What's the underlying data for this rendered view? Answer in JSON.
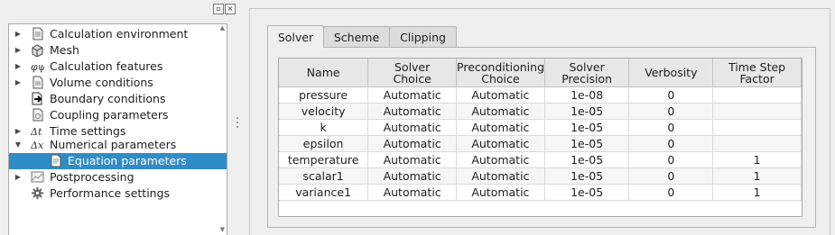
{
  "tree": {
    "items": [
      {
        "label": "Calculation environment",
        "icon": "folder-document-icon",
        "expander": "collapsed",
        "selected": false
      },
      {
        "label": "Mesh",
        "icon": "mesh-cube-icon",
        "expander": "collapsed",
        "selected": false
      },
      {
        "label": "Calculation features",
        "icon": "phi-psi-icon",
        "expander": "collapsed",
        "selected": false
      },
      {
        "label": "Volume conditions",
        "icon": "volume-document-icon",
        "expander": "collapsed",
        "selected": false
      },
      {
        "label": "Boundary conditions",
        "icon": "boundary-arrow-icon",
        "expander": "none",
        "selected": false
      },
      {
        "label": "Coupling parameters",
        "icon": "coupling-document-icon",
        "expander": "none",
        "selected": false
      },
      {
        "label": "Time settings",
        "icon": "delta-t-icon",
        "expander": "collapsed",
        "selected": false
      },
      {
        "label": "Numerical parameters",
        "icon": "delta-x-icon",
        "expander": "expanded",
        "selected": false
      },
      {
        "label": "Equation parameters",
        "icon": "equation-document-icon",
        "expander": "none",
        "selected": true
      },
      {
        "label": "Postprocessing",
        "icon": "chart-icon",
        "expander": "collapsed",
        "selected": false
      },
      {
        "label": "Performance settings",
        "icon": "gear-icon",
        "expander": "none",
        "selected": false
      }
    ]
  },
  "tabs": [
    "Solver",
    "Scheme",
    "Clipping"
  ],
  "active_tab": "Solver",
  "table": {
    "headers": [
      "Name",
      "Solver\nChoice",
      "Preconditioning\nChoice",
      "Solver\nPrecision",
      "Verbosity",
      "Time Step\nFactor"
    ],
    "rows": [
      [
        "pressure",
        "Automatic",
        "Automatic",
        "1e-08",
        "0",
        ""
      ],
      [
        "velocity",
        "Automatic",
        "Automatic",
        "1e-05",
        "0",
        ""
      ],
      [
        "k",
        "Automatic",
        "Automatic",
        "1e-05",
        "0",
        ""
      ],
      [
        "epsilon",
        "Automatic",
        "Automatic",
        "1e-05",
        "0",
        ""
      ],
      [
        "temperature",
        "Automatic",
        "Automatic",
        "1e-05",
        "0",
        "1"
      ],
      [
        "scalar1",
        "Automatic",
        "Automatic",
        "1e-05",
        "0",
        "1"
      ],
      [
        "variance1",
        "Automatic",
        "Automatic",
        "1e-05",
        "0",
        "1"
      ]
    ]
  },
  "colors": {
    "selection": "#308cc6",
    "header_bg": "#e7e7e7",
    "alt_row": "#f6f6f6"
  }
}
